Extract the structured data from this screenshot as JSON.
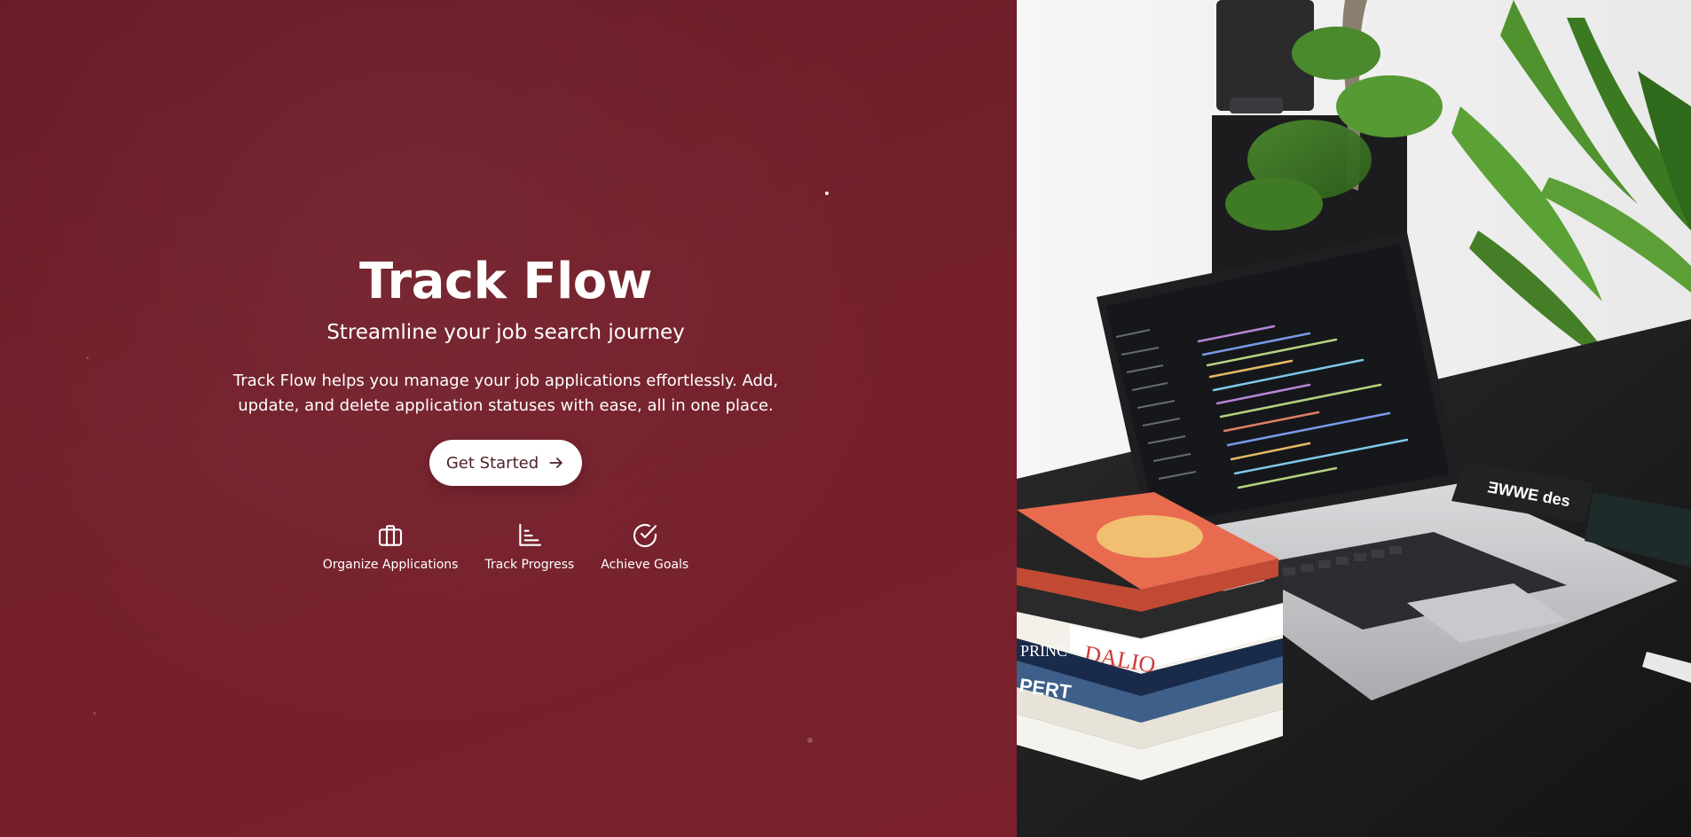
{
  "hero": {
    "title": "Track Flow",
    "subtitle": "Streamline your job search journey",
    "description": "Track Flow helps you manage your job applications effortlessly. Add, update, and delete application statuses with ease, all in one place.",
    "cta_label": "Get Started",
    "cta_icon": "arrow-right-icon"
  },
  "features": [
    {
      "label": "Organize Applications",
      "icon": "briefcase-icon"
    },
    {
      "label": "Track Progress",
      "icon": "bar-chart-icon"
    },
    {
      "label": "Achieve Goals",
      "icon": "check-circle-icon"
    }
  ],
  "photo": {
    "book_text_1": "DALIO",
    "book_text_2": "PRINC",
    "book_text_3": "PERT",
    "pouch_text": "ƎWWE des"
  },
  "colors": {
    "hero_background": "#74202b",
    "button_background": "#ffffff",
    "button_text": "#4a1b22"
  }
}
